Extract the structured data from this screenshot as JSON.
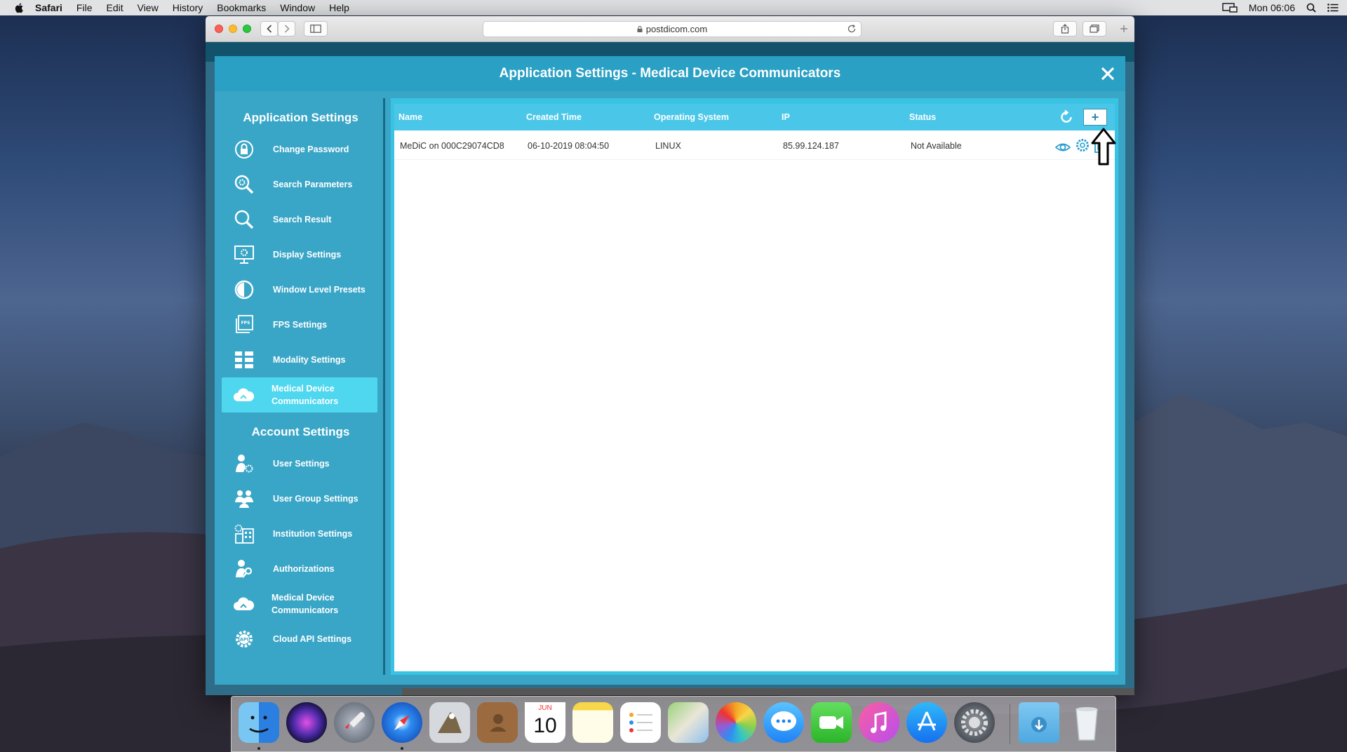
{
  "menubar": {
    "app": "Safari",
    "items": [
      "File",
      "Edit",
      "View",
      "History",
      "Bookmarks",
      "Window",
      "Help"
    ],
    "clock": "Mon 06:06"
  },
  "browser": {
    "url": "postdicom.com"
  },
  "modal": {
    "title": "Application Settings - Medical Device Communicators",
    "close_icon": "close-icon"
  },
  "sidebar": {
    "app_heading": "Application Settings",
    "app_items": [
      {
        "label": "Change Password",
        "icon": "lock-icon"
      },
      {
        "label": "Search Parameters",
        "icon": "search-gear-icon"
      },
      {
        "label": "Search Result",
        "icon": "search-icon"
      },
      {
        "label": "Display Settings",
        "icon": "monitor-gear-icon"
      },
      {
        "label": "Window Level Presets",
        "icon": "contrast-icon"
      },
      {
        "label": "FPS Settings",
        "icon": "fps-icon"
      },
      {
        "label": "Modality Settings",
        "icon": "grid-icon"
      },
      {
        "label": "Medical Device Communicators",
        "icon": "cloud-icon",
        "active": true
      }
    ],
    "account_heading": "Account Settings",
    "account_items": [
      {
        "label": "User Settings",
        "icon": "user-gear-icon"
      },
      {
        "label": "User Group Settings",
        "icon": "users-icon"
      },
      {
        "label": "Institution Settings",
        "icon": "building-icon"
      },
      {
        "label": "Authorizations",
        "icon": "key-icon"
      },
      {
        "label": "Medical Device Communicators",
        "icon": "cloud-icon"
      },
      {
        "label": "Cloud API Settings",
        "icon": "api-gear-icon"
      }
    ]
  },
  "table": {
    "headers": [
      "Name",
      "Created Time",
      "Operating System",
      "IP",
      "Status"
    ],
    "rows": [
      {
        "name": "MeDiC on 000C29074CD8",
        "created": "06-10-2019 08:04:50",
        "os": "LINUX",
        "ip": "85.99.124.187",
        "status": "Not Available"
      }
    ],
    "add_label": "+",
    "refresh_icon": "refresh-icon"
  },
  "dock": {
    "calendar_month": "JUN",
    "calendar_day": "10"
  },
  "colors": {
    "modal_bg": "#3aa6c7",
    "header_bg": "#2aa0c4",
    "table_head": "#4ac7e8",
    "active_item": "#4fd7ef"
  }
}
